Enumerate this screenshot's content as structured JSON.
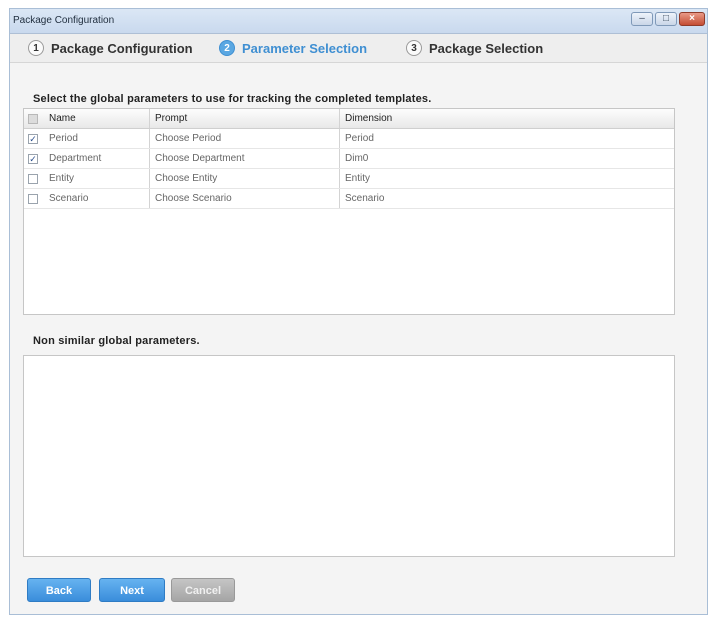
{
  "window": {
    "title": "Package Configuration",
    "controls": {
      "minimize": "–",
      "maximize": "□",
      "close": "×"
    }
  },
  "wizard": {
    "steps": [
      {
        "number": "1",
        "label": "Package Configuration",
        "active": false
      },
      {
        "number": "2",
        "label": "Parameter Selection",
        "active": true
      },
      {
        "number": "3",
        "label": "Package Selection",
        "active": false
      }
    ]
  },
  "main": {
    "global_params_label": "Select the global parameters to use for tracking the completed templates.",
    "table": {
      "columns": [
        "Name",
        "Prompt",
        "Dimension"
      ],
      "rows": [
        {
          "checked": true,
          "name": "Period",
          "prompt": "Choose Period",
          "dimension": "Period"
        },
        {
          "checked": true,
          "name": "Department",
          "prompt": "Choose Department",
          "dimension": "Dim0"
        },
        {
          "checked": false,
          "name": "Entity",
          "prompt": "Choose Entity",
          "dimension": "Entity"
        },
        {
          "checked": false,
          "name": "Scenario",
          "prompt": "Choose Scenario",
          "dimension": "Scenario"
        }
      ]
    },
    "non_similar_label": "Non similar global parameters."
  },
  "footer": {
    "back_label": "Back",
    "next_label": "Next",
    "cancel_label": "Cancel"
  },
  "colors": {
    "accent": "#3f8fd2",
    "primary_button": "#3a8ddb",
    "disabled_button": "#a5a5a5"
  }
}
